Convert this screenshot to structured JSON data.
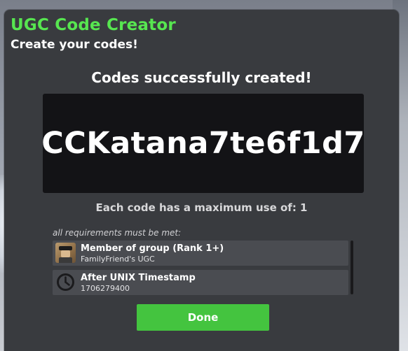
{
  "colors": {
    "accent_green": "#57e650",
    "button_green": "#44c43f",
    "modal_bg": "#393b3f",
    "code_bg": "#131316",
    "item_bg": "#4a4c51"
  },
  "header": {
    "title": "UGC Code Creator",
    "subtitle": "Create your codes!"
  },
  "result": {
    "message": "Codes successfully created!",
    "code": "CCKatana7te6f1d7",
    "max_use": "Each code has a maximum use of: 1"
  },
  "requirements": {
    "caption": "all requirements must be met:",
    "items": [
      {
        "title": "Member of group (Rank 1+)",
        "detail": "FamilyFriend's UGC",
        "icon": "group-avatar-icon"
      },
      {
        "title": "After UNIX Timestamp",
        "detail": "1706279400",
        "icon": "clock-icon"
      }
    ]
  },
  "actions": {
    "done_label": "Done"
  }
}
